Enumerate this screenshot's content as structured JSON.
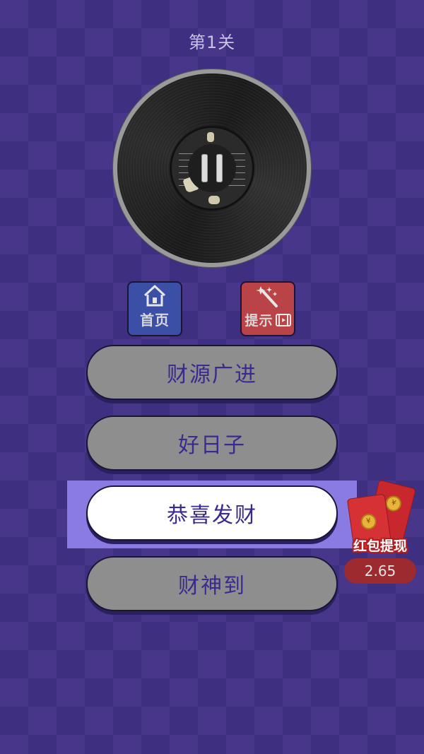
{
  "level": {
    "title": "第1关"
  },
  "player": {
    "state": "paused"
  },
  "buttons": {
    "home": {
      "label": "首页",
      "icon": "home-icon"
    },
    "hint": {
      "label": "提示",
      "icon": "magic-wand-icon",
      "badge_icon": "video-icon"
    }
  },
  "answers": [
    {
      "text": "财源广进",
      "selected": false
    },
    {
      "text": "好日子",
      "selected": false
    },
    {
      "text": "恭喜发财",
      "selected": true
    },
    {
      "text": "财神到",
      "selected": false
    }
  ],
  "red_packet": {
    "label": "红包提现",
    "amount": "2.65"
  },
  "colors": {
    "background": "#47368a",
    "answer_default": "#8e8e8e",
    "answer_selected": "#ffffff",
    "answer_text": "#3a2a8f",
    "highlight": "#8e80e8",
    "home_button": "#3c4fa6",
    "hint_button": "#b94346",
    "red_packet": "#d63236"
  }
}
